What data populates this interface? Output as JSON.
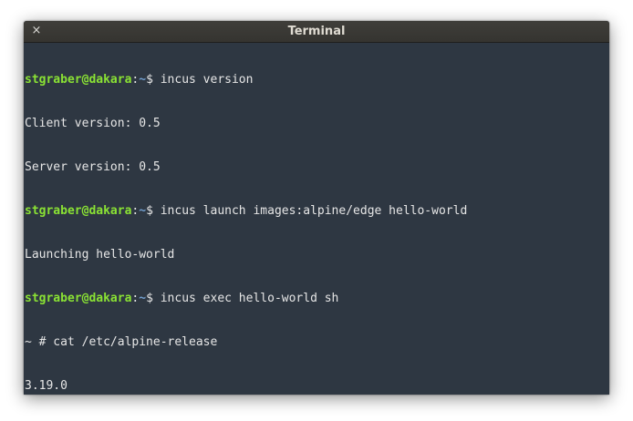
{
  "window": {
    "title": "Terminal",
    "close_icon": "×"
  },
  "terminal": {
    "colors": {
      "background": "#2e3742",
      "user_host": "#8ae234",
      "path": "#729fcf",
      "text": "#e6e6e6"
    },
    "lines": [
      {
        "user_host": "stgraber@dakara",
        "sep": ":",
        "path": "~",
        "prompt": "$ ",
        "command": "incus version"
      },
      {
        "text": "Client version: 0.5"
      },
      {
        "text": "Server version: 0.5"
      },
      {
        "user_host": "stgraber@dakara",
        "sep": ":",
        "path": "~",
        "prompt": "$ ",
        "command": "incus launch images:alpine/edge hello-world"
      },
      {
        "text": "Launching hello-world"
      },
      {
        "user_host": "stgraber@dakara",
        "sep": ":",
        "path": "~",
        "prompt": "$ ",
        "command": "incus exec hello-world sh"
      },
      {
        "text": "~ # cat /etc/alpine-release"
      },
      {
        "text": "3.19.0"
      },
      {
        "text": "~ # "
      }
    ]
  }
}
